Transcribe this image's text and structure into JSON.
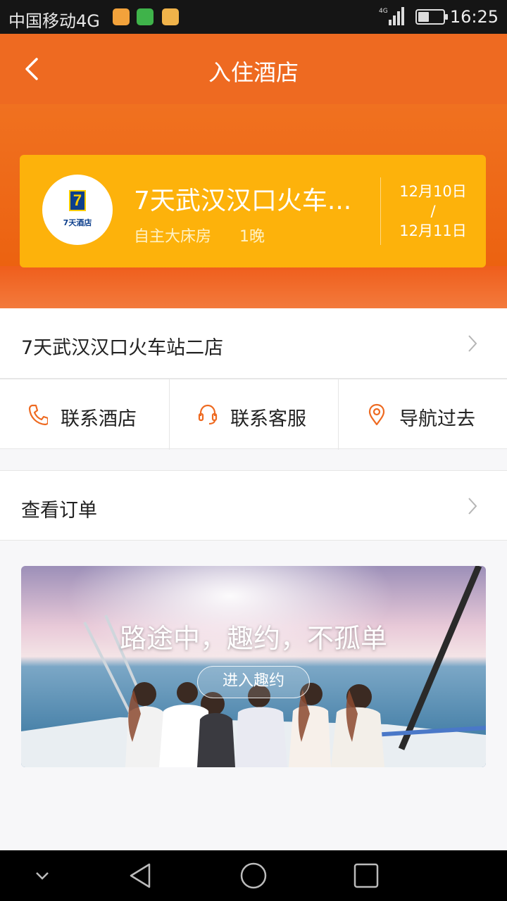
{
  "status_bar": {
    "carrier": "中国移动4G",
    "network": "4G",
    "time": "16:25",
    "battery_level": 0.45
  },
  "header": {
    "title": "入住酒店",
    "back_icon": "chevron-left-icon"
  },
  "hotel_card": {
    "logo_badge": "7",
    "logo_text": "7天酒店",
    "name": "7天武汉汉口火车...",
    "room_type": "自主大床房",
    "nights": "1晚",
    "check_in": "12月10日",
    "separator": "/",
    "check_out": "12月11日"
  },
  "hotel_row": {
    "label": "7天武汉汉口火车站二店"
  },
  "actions": [
    {
      "label": "联系酒店",
      "icon": "phone-icon"
    },
    {
      "label": "联系客服",
      "icon": "headset-icon"
    },
    {
      "label": "导航过去",
      "icon": "location-pin-icon"
    }
  ],
  "order_row": {
    "label": "查看订单"
  },
  "banner": {
    "headline": "路途中，趣约，不孤单",
    "button": "进入趣约"
  },
  "colors": {
    "accent": "#ee6a21",
    "card": "#fdb20b",
    "icon": "#ee6a21"
  }
}
